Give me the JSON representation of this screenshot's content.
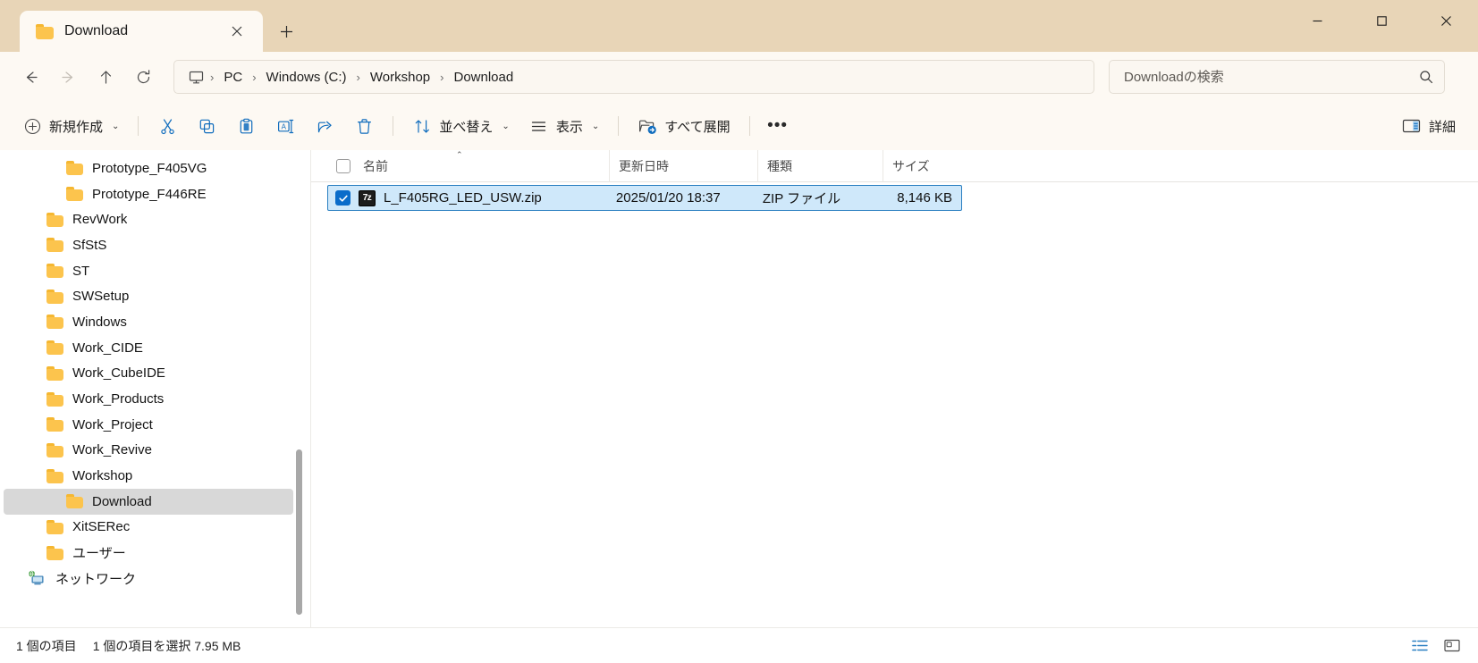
{
  "window": {
    "tab_title": "Download",
    "tab_close_label": "✕",
    "new_tab_label": "+",
    "minimize_label": "minimize",
    "maximize_label": "maximize",
    "close_label": "close"
  },
  "address": {
    "back_icon": "arrow-left-icon",
    "forward_icon": "arrow-right-icon",
    "up_icon": "arrow-up-icon",
    "refresh_icon": "refresh-icon",
    "breadcrumb": [
      {
        "label": "PC"
      },
      {
        "label": "Windows (C:)"
      },
      {
        "label": "Workshop"
      },
      {
        "label": "Download"
      }
    ],
    "separator": "›",
    "search_placeholder": "Downloadの検索",
    "search_value": ""
  },
  "toolbar": {
    "new_label": "新規作成",
    "cut_label": "切り取り",
    "copy_label": "コピー",
    "paste_label": "貼り付け",
    "rename_label": "名前の変更",
    "share_label": "共有",
    "delete_label": "削除",
    "sort_label": "並べ替え",
    "view_label": "表示",
    "extract_label": "すべて展開",
    "more_label": "•••",
    "details_label": "詳細",
    "chevron": "⌄"
  },
  "sidebar": {
    "items": [
      {
        "label": "Prototype_F405VG",
        "icon": "folder-icon",
        "indent": 2,
        "selected": false
      },
      {
        "label": "Prototype_F446RE",
        "icon": "folder-icon",
        "indent": 2,
        "selected": false
      },
      {
        "label": "RevWork",
        "icon": "folder-icon",
        "indent": 1,
        "selected": false
      },
      {
        "label": "SfStS",
        "icon": "folder-icon",
        "indent": 1,
        "selected": false
      },
      {
        "label": "ST",
        "icon": "folder-icon",
        "indent": 1,
        "selected": false
      },
      {
        "label": "SWSetup",
        "icon": "folder-icon",
        "indent": 1,
        "selected": false
      },
      {
        "label": "Windows",
        "icon": "folder-icon",
        "indent": 1,
        "selected": false
      },
      {
        "label": "Work_CIDE",
        "icon": "folder-icon",
        "indent": 1,
        "selected": false
      },
      {
        "label": "Work_CubeIDE",
        "icon": "folder-icon",
        "indent": 1,
        "selected": false
      },
      {
        "label": "Work_Products",
        "icon": "folder-icon",
        "indent": 1,
        "selected": false
      },
      {
        "label": "Work_Project",
        "icon": "folder-icon",
        "indent": 1,
        "selected": false
      },
      {
        "label": "Work_Revive",
        "icon": "folder-icon",
        "indent": 1,
        "selected": false
      },
      {
        "label": "Workshop",
        "icon": "folder-icon",
        "indent": 1,
        "selected": false
      },
      {
        "label": "Download",
        "icon": "folder-icon",
        "indent": 2,
        "selected": true
      },
      {
        "label": "XitSERec",
        "icon": "folder-icon",
        "indent": 1,
        "selected": false
      },
      {
        "label": "ユーザー",
        "icon": "folder-icon",
        "indent": 1,
        "selected": false
      },
      {
        "label": "ネットワーク",
        "icon": "network-icon",
        "indent": 0,
        "selected": false
      }
    ]
  },
  "filelist": {
    "columns": [
      {
        "label": "名前"
      },
      {
        "label": "更新日時"
      },
      {
        "label": "種類"
      },
      {
        "label": "サイズ"
      }
    ],
    "sort_caret": "⌃",
    "rows": [
      {
        "name": "L_F405RG_LED_USW.zip",
        "date": "2025/01/20 18:37",
        "type": "ZIP ファイル",
        "size": "8,146 KB",
        "icon": "zip-file-icon",
        "icon_text": "7z",
        "selected": true,
        "checked": true
      }
    ]
  },
  "statusbar": {
    "item_count": "1 個の項目",
    "selection": "1 個の項目を選択  7.95 MB",
    "list_view_icon": "list-view-icon",
    "details_view_icon": "details-view-icon"
  },
  "colors": {
    "titlebar": "#e8d5b7",
    "chrome": "#fdf9f3",
    "accent": "#0f6cbd",
    "selection": "#cfe8fa",
    "selection_border": "#2a7fc1",
    "folder": "#fcc44d"
  }
}
